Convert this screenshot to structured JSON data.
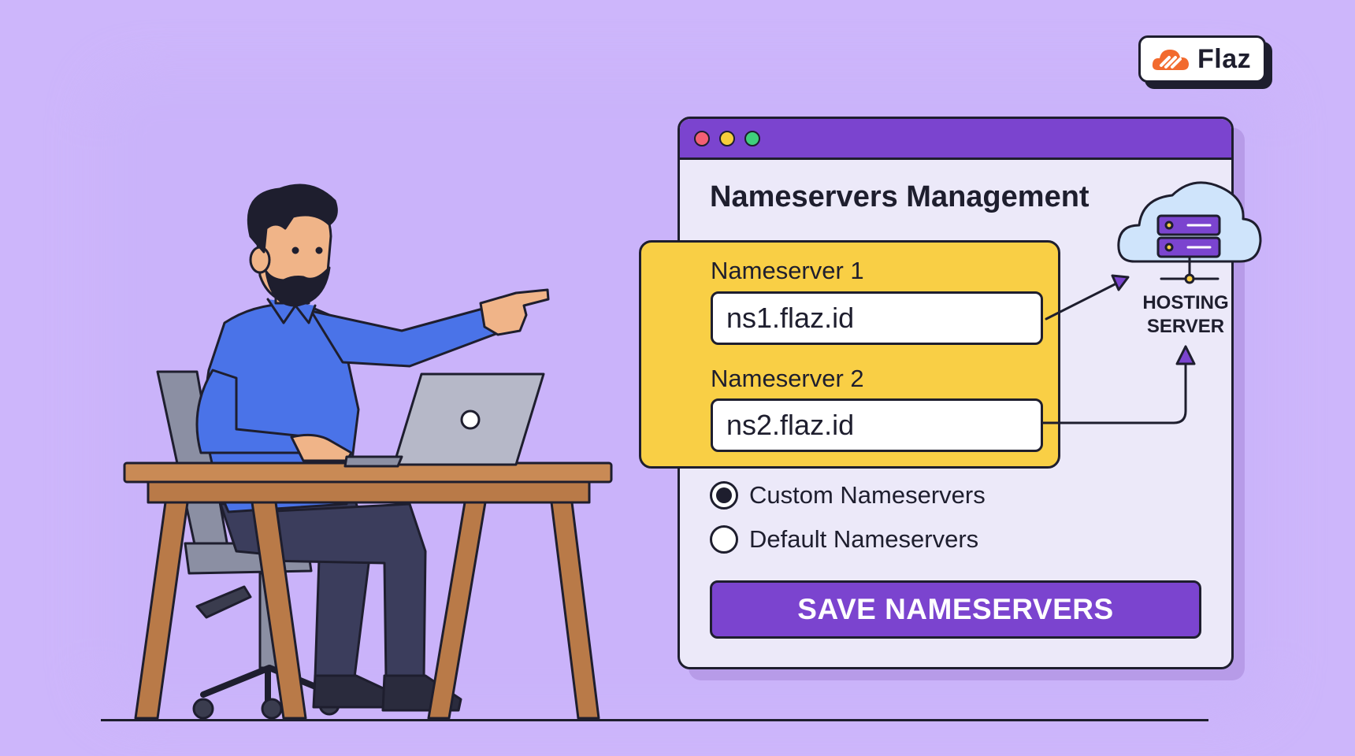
{
  "brand": {
    "name": "Flaz"
  },
  "window": {
    "title": "Nameservers Management",
    "nameserver1": {
      "label": "Nameserver 1",
      "value": "ns1.flaz.id"
    },
    "nameserver2": {
      "label": "Nameserver 2",
      "value": "ns2.flaz.id"
    },
    "options": [
      {
        "label": "Custom Nameservers",
        "selected": true
      },
      {
        "label": "Default Nameservers",
        "selected": false
      }
    ],
    "save_label": "SAVE NAMESERVERS"
  },
  "server": {
    "label_line1": "HOSTING",
    "label_line2": "SERVER"
  },
  "colors": {
    "background": "#cdb6fb",
    "accent": "#7b44cf",
    "highlight": "#f9cf45",
    "shirt": "#4a73e8"
  }
}
